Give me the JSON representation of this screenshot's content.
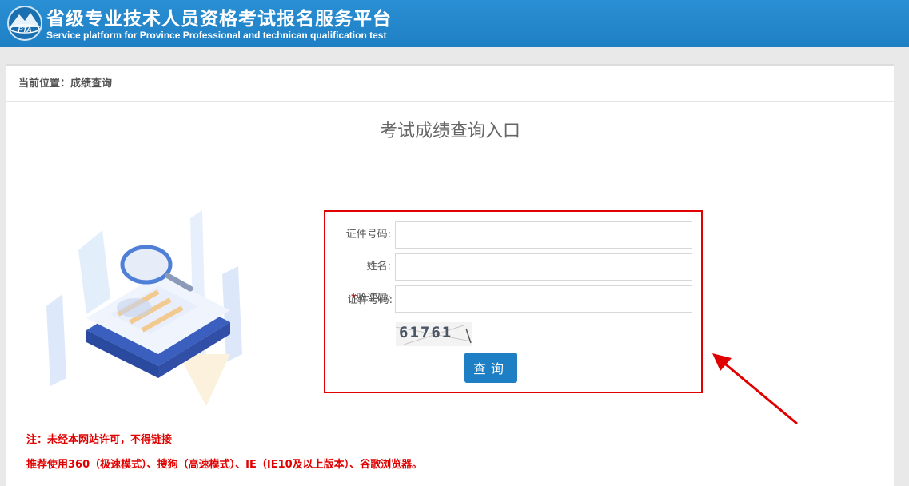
{
  "header": {
    "logo_text": "PTA",
    "title_cn": "省级专业技术人员资格考试报名服务平台",
    "title_en": "Service platform for Province Professional and technican qualification test"
  },
  "breadcrumb": "当前位置：成绩查询",
  "entry_title": "考试成绩查询入口",
  "form": {
    "id_label": "证件号码:",
    "name_label": "姓名:",
    "captcha_required_mark": "*",
    "captcha_label": "验证码:",
    "id_value": "",
    "name_value": "",
    "captcha_value": "",
    "captcha_image_text": "61761",
    "submit_label": "查询"
  },
  "notes": {
    "line1": "注：未经本网站许可，不得链接",
    "line2": "推荐使用360（极速模式）、搜狗（高速模式）、IE（IE10及以上版本）、谷歌浏览器。"
  },
  "colors": {
    "header_blue": "#1f7fc4",
    "alert_red": "#e00000"
  }
}
